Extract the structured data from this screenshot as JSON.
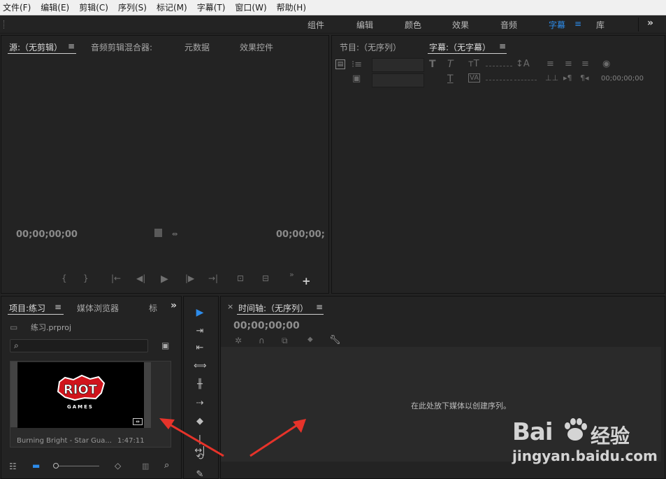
{
  "menubar": [
    "文件(F)",
    "编辑(E)",
    "剪辑(C)",
    "序列(S)",
    "标记(M)",
    "字幕(T)",
    "窗口(W)",
    "帮助(H)"
  ],
  "workspaces": [
    "组件",
    "编辑",
    "颜色",
    "效果",
    "音频",
    "字幕",
    "库"
  ],
  "active_workspace": "字幕",
  "workspace_menu_icon": "≡",
  "workspace_more": "»",
  "source_panel": {
    "tabs": [
      "源:（无剪辑）",
      "音频剪辑混合器:",
      "元数据",
      "效果控件"
    ],
    "timecode_left": "00;00;00;00",
    "timecode_right": "00;00;00;",
    "menu_icon": "≡",
    "controls": [
      "{",
      "}",
      "|←",
      "◀|",
      "▶",
      "|▶",
      "→|",
      "⊡",
      "⊟",
      "»",
      "+"
    ]
  },
  "program_panel": {
    "tabs": [
      "节目:（无序列）",
      "字幕:（无字幕）"
    ],
    "menu_icon": "≡",
    "caption_timecode": "00;00;00;00"
  },
  "project_panel": {
    "tabs": [
      "项目:练习",
      "媒体浏览器",
      "标"
    ],
    "menu_icon": "≡",
    "more": "»",
    "project_file": "练习.prproj",
    "clip": {
      "name": "Burning Bright - Star Gua...",
      "duration": "1:47:11",
      "logo_top": "RIOT",
      "logo_bottom": "GAMES"
    }
  },
  "tools": [
    "▶",
    "⇥",
    "⇤",
    "⟺",
    "╫",
    "⇢",
    "◆",
    "|↔|",
    "⟲",
    "✎"
  ],
  "timeline_panel": {
    "close": "×",
    "title": "时间轴:（无序列）",
    "menu_icon": "≡",
    "timecode": "00;00;00;00",
    "hint": "在此处放下媒体以创建序列。"
  },
  "watermark": {
    "brand": "Bai",
    "brand_suffix": "经验",
    "url": "jingyan.baidu.com"
  },
  "colors": {
    "accent": "#2d8ceb",
    "arrow": "#e6332a",
    "bg": "#232323"
  }
}
